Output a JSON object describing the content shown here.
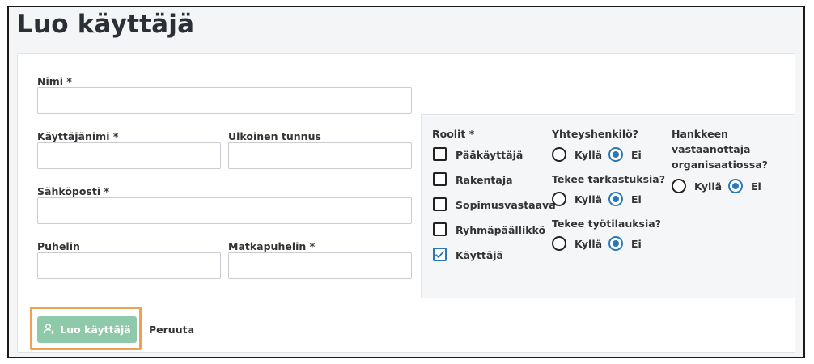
{
  "page": {
    "title": "Luo käyttäjä"
  },
  "form": {
    "name": {
      "label": "Nimi *",
      "value": ""
    },
    "username": {
      "label": "Käyttäjänimi *",
      "value": ""
    },
    "external_id": {
      "label": "Ulkoinen tunnus",
      "value": ""
    },
    "email": {
      "label": "Sähköposti *",
      "value": ""
    },
    "phone": {
      "label": "Puhelin",
      "value": ""
    },
    "mobile": {
      "label": "Matkapuhelin *",
      "value": ""
    }
  },
  "roles": {
    "title": "Roolit *",
    "items": [
      {
        "label": "Pääkäyttäjä",
        "checked": false
      },
      {
        "label": "Rakentaja",
        "checked": false
      },
      {
        "label": "Sopimusvastaava",
        "checked": false
      },
      {
        "label": "Ryhmäpäällikkö",
        "checked": false
      },
      {
        "label": "Käyttäjä",
        "checked": true
      }
    ]
  },
  "questions": {
    "contact": {
      "title": "Yhteyshenkilö?",
      "yes": "Kyllä",
      "no": "Ei",
      "selected": "no"
    },
    "inspections": {
      "title": "Tekee tarkastuksia?",
      "yes": "Kyllä",
      "no": "Ei",
      "selected": "no"
    },
    "work_orders": {
      "title": "Tekee työtilauksia?",
      "yes": "Kyllä",
      "no": "Ei",
      "selected": "no"
    },
    "project_receiver": {
      "title_line1": "Hankkeen",
      "title_line2": "vastaanottaja",
      "title_line3": "organisaatiossa?",
      "yes": "Kyllä",
      "no": "Ei",
      "selected": "no"
    }
  },
  "actions": {
    "create_label": "Luo käyttäjä",
    "cancel_label": "Peruuta"
  },
  "colors": {
    "accent": "#2b78b8",
    "create_button": "#8ec9a9",
    "highlight": "#f0a050"
  }
}
